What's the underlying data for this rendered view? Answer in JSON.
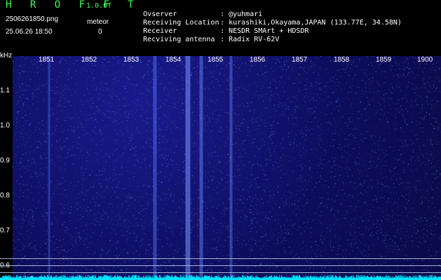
{
  "header": {
    "app_title": "H R O F F T",
    "app_version": "1.0.0f",
    "file_name": "2506261850.png",
    "timestamp": "25.06.26 18:50",
    "meteor_label": "meteor",
    "meteor_count": "0"
  },
  "info": [
    {
      "key": "Ovserver",
      "sep": ":",
      "value": "@yuhmari"
    },
    {
      "key": "Receiving Location",
      "sep": ":",
      "value": "kurashiki,Okayama,JAPAN (133.77E, 34.58N)"
    },
    {
      "key": "Receiver",
      "sep": ":",
      "value": "NESDR SMArt + HDSDR"
    },
    {
      "key": "Recviving antenna",
      "sep": ":",
      "value": "Radix RV-62V"
    }
  ],
  "spectrogram": {
    "freq_unit": "kHz",
    "time_ticks": [
      "1851",
      "1852",
      "1853",
      "1854",
      "1855",
      "1856",
      "1857",
      "1858",
      "1859",
      "1900"
    ],
    "freq_ticks": [
      "1.1",
      "1.0",
      "0.9",
      "0.8",
      "0.7",
      "0.6"
    ]
  },
  "colors": {
    "title_green": "#39ff5a",
    "background": "#000000",
    "spectrum_blue": "#0c0c5a",
    "signal_cyan": "#00e5ff"
  }
}
